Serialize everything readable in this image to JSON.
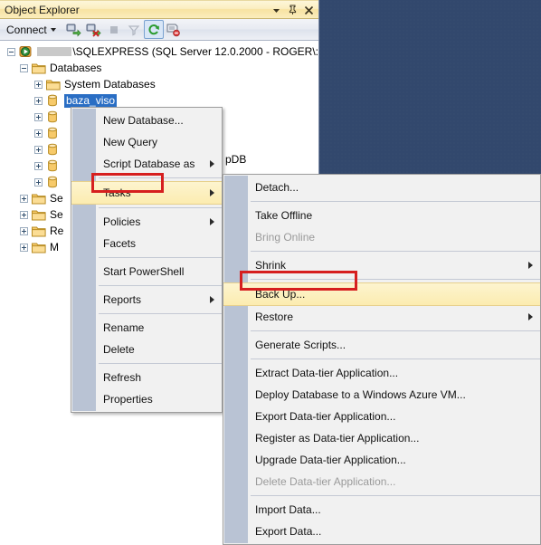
{
  "panel": {
    "title": "Object Explorer",
    "title_buttons": [
      {
        "name": "window-dropdown-icon",
        "glyph": "▾"
      },
      {
        "name": "pin-icon",
        "glyph": "pin"
      },
      {
        "name": "close-icon",
        "glyph": "✕"
      }
    ],
    "toolbar": {
      "connect_label": "Connect",
      "icons": [
        {
          "name": "connect-object-explorer-icon",
          "state": "enabled"
        },
        {
          "name": "disconnect-object-explorer-icon",
          "state": "enabled"
        },
        {
          "name": "stop-icon",
          "state": "disabled"
        },
        {
          "name": "filter-icon",
          "state": "disabled"
        },
        {
          "name": "refresh-icon",
          "state": "active"
        },
        {
          "name": "sync-with-editor-icon",
          "state": "enabled"
        }
      ]
    }
  },
  "tree": {
    "server_node": {
      "name_redacted": true,
      "label": "\\SQLEXPRESS (SQL Server 12.0.2000 - ROGER\\:",
      "expander": "minus",
      "icon": "server-icon"
    },
    "nodes": [
      {
        "label": "Databases",
        "indent": 1,
        "expander": "minus",
        "icon": "folder-icon"
      },
      {
        "label": "System Databases",
        "indent": 2,
        "expander": "plus",
        "icon": "folder-icon"
      },
      {
        "label": "baza_viso",
        "indent": 2,
        "expander": "plus",
        "icon": "database-icon",
        "selected": true
      },
      {
        "label": "",
        "indent": 2,
        "expander": "plus",
        "icon": "database-icon"
      },
      {
        "label": "",
        "indent": 2,
        "expander": "plus",
        "icon": "database-icon"
      },
      {
        "label": "",
        "indent": 2,
        "expander": "plus",
        "icon": "database-icon"
      },
      {
        "label": "",
        "indent": 2,
        "expander": "plus",
        "icon": "database-icon"
      },
      {
        "label": "",
        "indent": 2,
        "expander": "plus",
        "icon": "database-icon"
      },
      {
        "label": "Se",
        "indent": 1,
        "expander": "plus",
        "icon": "folder-icon"
      },
      {
        "label": "Se",
        "indent": 1,
        "expander": "plus",
        "icon": "folder-icon"
      },
      {
        "label": "Re",
        "indent": 1,
        "expander": "plus",
        "icon": "folder-icon"
      },
      {
        "label": "M",
        "indent": 1,
        "expander": "plus",
        "icon": "folder-icon"
      }
    ],
    "partial_text": "pDB"
  },
  "menu_database": {
    "items": [
      {
        "label": "New Database...",
        "submenu": false,
        "disabled": false
      },
      {
        "label": "New Query",
        "submenu": false,
        "disabled": false
      },
      {
        "label": "Script Database as",
        "submenu": true,
        "disabled": false
      },
      {
        "sep": true
      },
      {
        "label": "Tasks",
        "submenu": true,
        "disabled": false,
        "highlight": true
      },
      {
        "sep": true
      },
      {
        "label": "Policies",
        "submenu": true,
        "disabled": false
      },
      {
        "label": "Facets",
        "submenu": false,
        "disabled": false
      },
      {
        "sep": true
      },
      {
        "label": "Start PowerShell",
        "submenu": false,
        "disabled": false
      },
      {
        "sep": true
      },
      {
        "label": "Reports",
        "submenu": true,
        "disabled": false
      },
      {
        "sep": true
      },
      {
        "label": "Rename",
        "submenu": false,
        "disabled": false
      },
      {
        "label": "Delete",
        "submenu": false,
        "disabled": false
      },
      {
        "sep": true
      },
      {
        "label": "Refresh",
        "submenu": false,
        "disabled": false
      },
      {
        "label": "Properties",
        "submenu": false,
        "disabled": false
      }
    ]
  },
  "menu_tasks": {
    "items": [
      {
        "label": "Detach...",
        "submenu": false,
        "disabled": false
      },
      {
        "sep": true
      },
      {
        "label": "Take Offline",
        "submenu": false,
        "disabled": false
      },
      {
        "label": "Bring Online",
        "submenu": false,
        "disabled": true
      },
      {
        "sep": true
      },
      {
        "label": "Shrink",
        "submenu": true,
        "disabled": false
      },
      {
        "sep": true
      },
      {
        "label": "Back Up...",
        "submenu": false,
        "disabled": false,
        "highlight": true
      },
      {
        "label": "Restore",
        "submenu": true,
        "disabled": false
      },
      {
        "sep": true
      },
      {
        "label": "Generate Scripts...",
        "submenu": false,
        "disabled": false
      },
      {
        "sep": true
      },
      {
        "label": "Extract Data-tier Application...",
        "submenu": false,
        "disabled": false
      },
      {
        "label": "Deploy Database to a Windows Azure VM...",
        "submenu": false,
        "disabled": false
      },
      {
        "label": "Export Data-tier Application...",
        "submenu": false,
        "disabled": false
      },
      {
        "label": "Register as Data-tier Application...",
        "submenu": false,
        "disabled": false
      },
      {
        "label": "Upgrade Data-tier Application...",
        "submenu": false,
        "disabled": false
      },
      {
        "label": "Delete Data-tier Application...",
        "submenu": false,
        "disabled": true
      },
      {
        "sep": true
      },
      {
        "label": "Import Data...",
        "submenu": false,
        "disabled": false
      },
      {
        "label": "Export Data...",
        "submenu": false,
        "disabled": false
      }
    ]
  },
  "annotations": {
    "highlight_color": "#d61f1f",
    "boxes": [
      {
        "name": "tasks-highlight-box"
      },
      {
        "name": "backup-highlight-box"
      }
    ]
  },
  "colors": {
    "workspace_bg": "#32486d",
    "title_gradient_top": "#fdf6d9",
    "selection_blue": "#2a6ec4",
    "menu_bg": "#f1f1f1",
    "menu_gutter": "#b9c3d4"
  }
}
